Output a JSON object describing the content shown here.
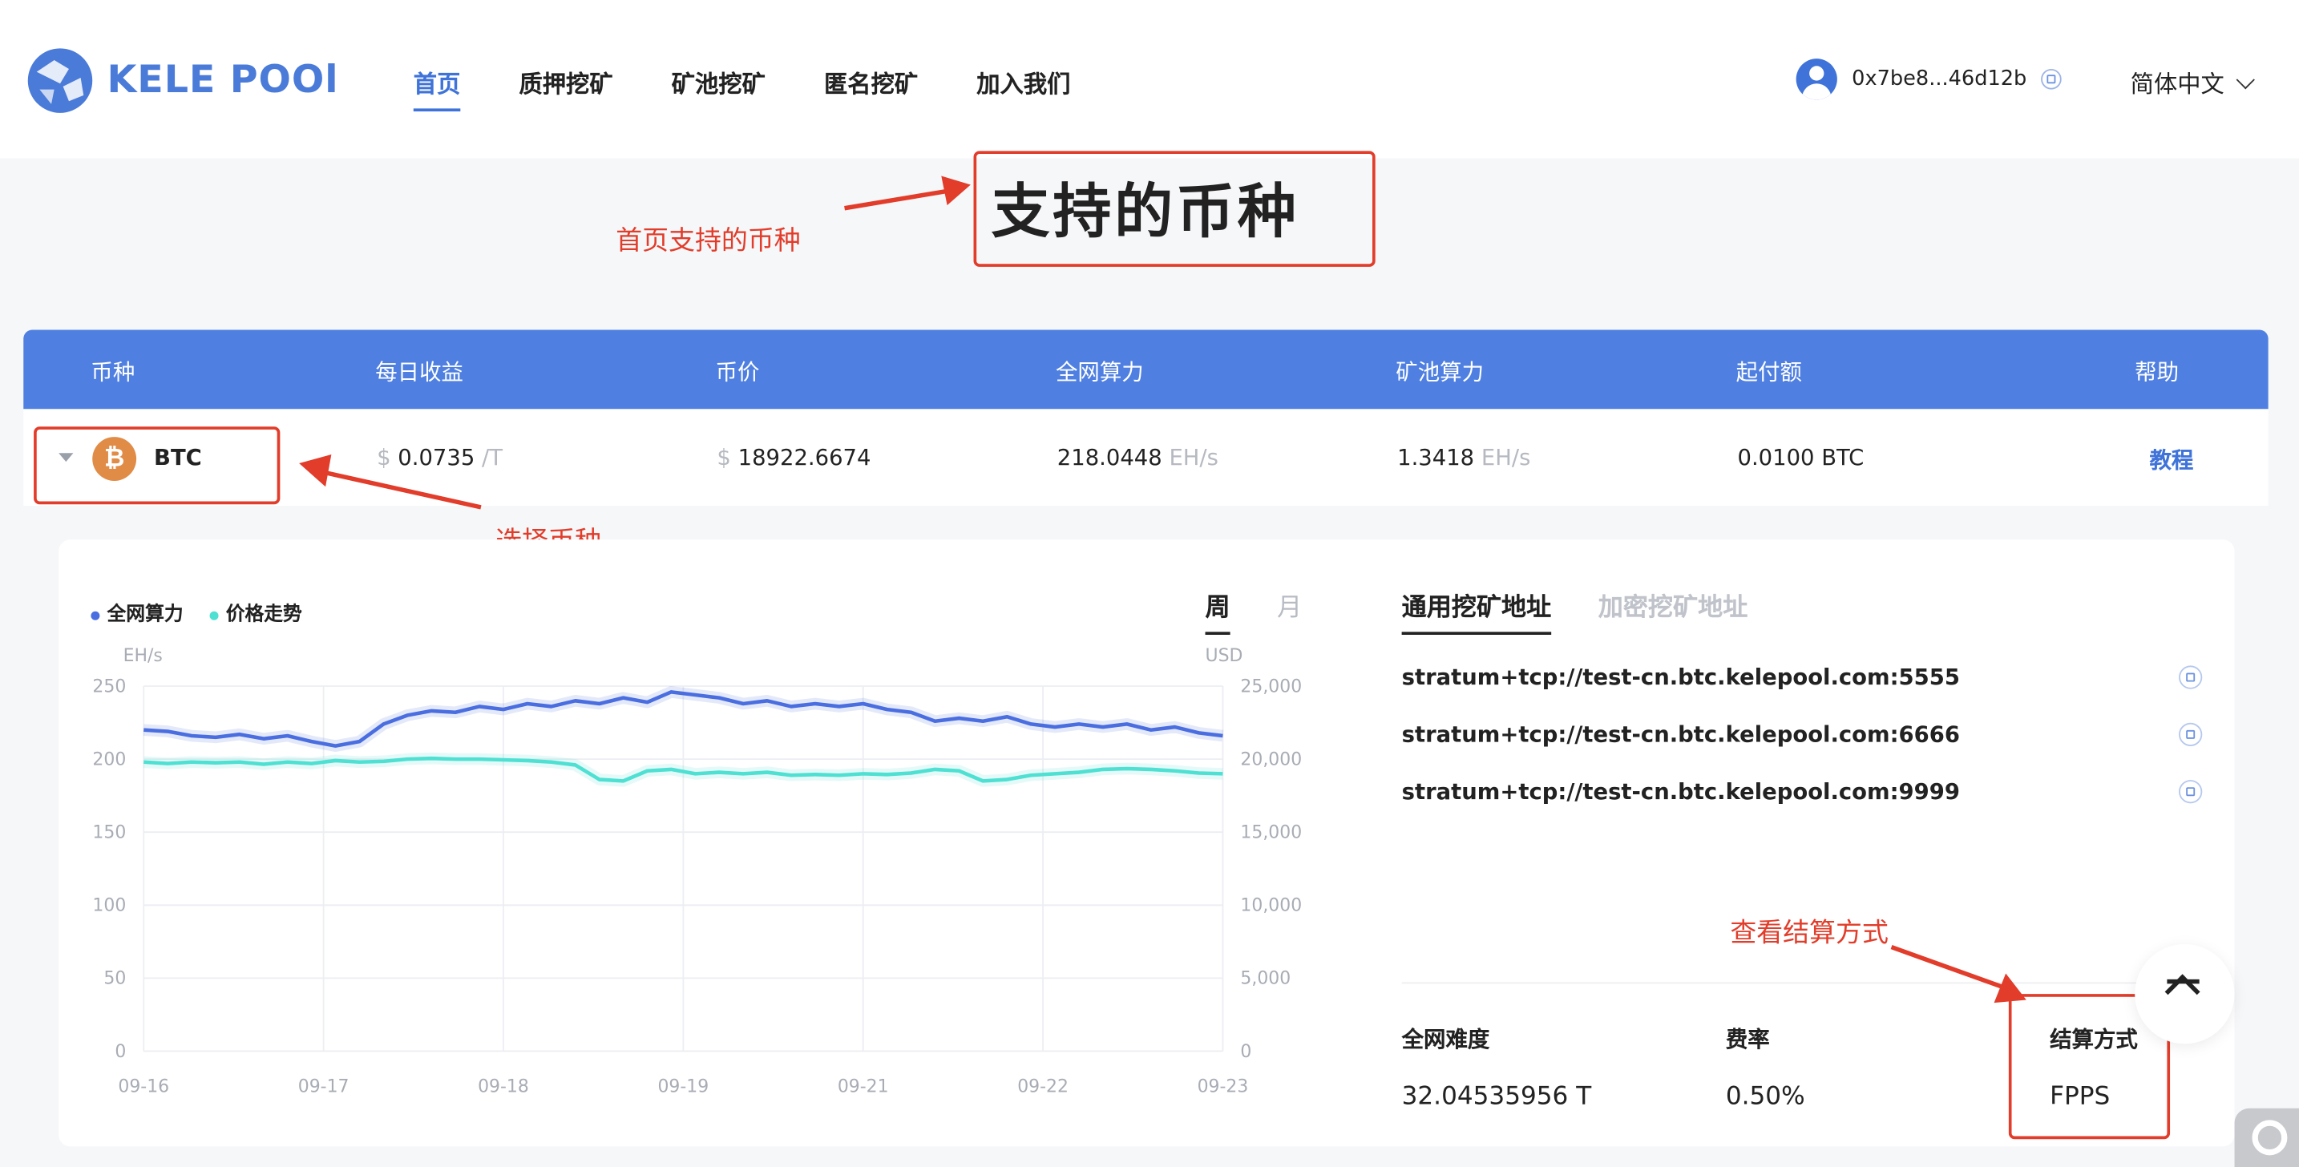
{
  "header": {
    "logo_text": "KELE POOl",
    "nav": [
      "首页",
      "质押挖矿",
      "矿池挖矿",
      "匿名挖矿",
      "加入我们"
    ],
    "wallet_address": "0x7be8...46d12b",
    "language": "简体中文"
  },
  "annotations": {
    "home_coins": "首页支持的币种",
    "select_coin": "选择币种",
    "settlement": "查看结算方式"
  },
  "page_title": "支持的币种",
  "table": {
    "headers": [
      "币种",
      "每日收益",
      "币价",
      "全网算力",
      "矿池算力",
      "起付额",
      "帮助"
    ],
    "row": {
      "coin": "BTC",
      "coin_symbol": "₿",
      "daily_prefix": "$",
      "daily_value": "0.0735",
      "daily_unit": "/T",
      "price_prefix": "$",
      "price_value": "18922.6674",
      "network_hash": "218.0448",
      "network_unit": "EH/s",
      "pool_hash": "1.3418",
      "pool_unit": "EH/s",
      "min_payout": "0.0100 BTC",
      "help_link": "教程"
    }
  },
  "chart_tabs": [
    "周",
    "月"
  ],
  "chart_data": {
    "type": "line",
    "legend": [
      "全网算力",
      "价格走势"
    ],
    "left_unit": "EH/s",
    "right_unit": "USD",
    "x_ticks": [
      "09-16",
      "09-17",
      "09-18",
      "09-19",
      "09-21",
      "09-22",
      "09-23"
    ],
    "y_left_ticks": [
      "250",
      "200",
      "150",
      "100",
      "50",
      "0"
    ],
    "y_right_ticks": [
      "25,000",
      "20,000",
      "15,000",
      "10,000",
      "5,000",
      "0"
    ],
    "ylim_left": [
      0,
      250
    ],
    "ylim_right": [
      0,
      25000
    ],
    "series": [
      {
        "name": "全网算力",
        "color": "#4a6ee0",
        "axis": "left",
        "values": [
          220,
          219,
          216,
          215,
          217,
          214,
          216,
          212,
          209,
          212,
          224,
          230,
          233,
          232,
          236,
          234,
          238,
          236,
          240,
          238,
          242,
          239,
          246,
          244,
          242,
          238,
          240,
          236,
          238,
          236,
          238,
          234,
          232,
          226,
          228,
          226,
          229,
          224,
          222,
          224,
          222,
          224,
          220,
          222,
          218,
          216
        ]
      },
      {
        "name": "价格走势",
        "color": "#4ee0d2",
        "axis": "right",
        "values": [
          19800,
          19700,
          19800,
          19750,
          19800,
          19650,
          19800,
          19700,
          19900,
          19800,
          19850,
          20000,
          20050,
          20000,
          20000,
          19950,
          19900,
          19800,
          19600,
          18600,
          18500,
          19200,
          19300,
          19000,
          19100,
          19000,
          19100,
          18900,
          18950,
          18900,
          19000,
          18950,
          19050,
          19300,
          19200,
          18500,
          18600,
          18900,
          19000,
          19100,
          19300,
          19350,
          19300,
          19200,
          19050,
          19000
        ]
      }
    ]
  },
  "address_tabs": [
    "通用挖矿地址",
    "加密挖矿地址"
  ],
  "addresses": [
    "stratum+tcp://test-cn.btc.kelepool.com:5555",
    "stratum+tcp://test-cn.btc.kelepool.com:6666",
    "stratum+tcp://test-cn.btc.kelepool.com:9999"
  ],
  "stats": {
    "difficulty_label": "全网难度",
    "difficulty_value": "32.04535956  T",
    "fee_label": "费率",
    "fee_value": "0.50%",
    "settlement_label": "结算方式",
    "settlement_value": "FPPS"
  },
  "colors": {
    "accent": "#3f73d9",
    "table_header": "#4f80e1",
    "annotation": "#e23c2a"
  }
}
